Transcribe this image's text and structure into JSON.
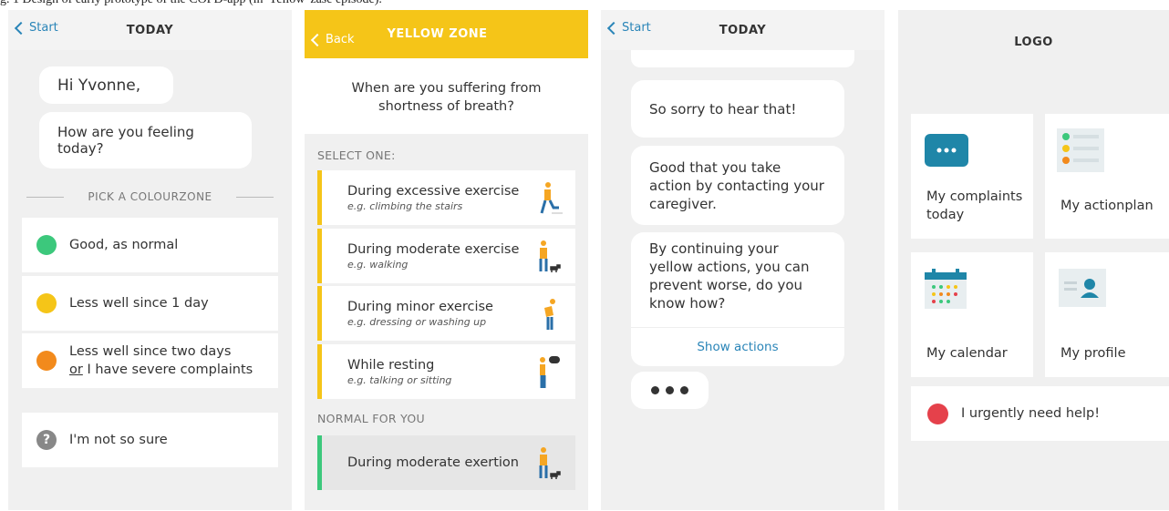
{
  "caption": "g. 1 Design of early prototype of the COPD-app (in 'Yellow' zase episode).",
  "screen1": {
    "back_label": "Start",
    "title": "TODAY",
    "greeting": "Hi Yvonne,",
    "question": "How are you feeling today?",
    "divider_label": "PICK A COLOURZONE",
    "zones": [
      {
        "label": "Good, as normal",
        "color": "#3cc87c"
      },
      {
        "label": "Less well since 1 day",
        "color": "#f5c518"
      },
      {
        "label_line1": "Less well since two days",
        "label_line2_or": "or",
        "label_line2_rest": " I have severe complaints",
        "color": "#f28a1c"
      }
    ],
    "unsure_label": "I'm not so sure",
    "unsure_icon": "?"
  },
  "screen2": {
    "back_label": "Back",
    "title": "YELLOW ZONE",
    "question_line1": "When are you suffering from",
    "question_line2": "shortness of breath?",
    "select_label": "SELECT ONE:",
    "options": [
      {
        "main": "During excessive exercise",
        "example": "e.g. climbing the stairs"
      },
      {
        "main": "During moderate exercise",
        "example": "e.g. walking"
      },
      {
        "main": "During minor exercise",
        "example": "e.g. dressing or washing up"
      },
      {
        "main": "While resting",
        "example": "e.g. talking or sitting"
      }
    ],
    "normal_label": "NORMAL FOR YOU",
    "normal_option": "During moderate exertion",
    "accent": "#f5c518",
    "normal_accent": "#3cc87c"
  },
  "screen3": {
    "back_label": "Start",
    "title": "TODAY",
    "messages": [
      "So sorry to hear that!",
      "Good that you take action by contacting your caregiver.",
      "By continuing your yellow actions, you can prevent worse, do you know how?"
    ],
    "show_actions": "Show actions"
  },
  "screen4": {
    "title": "LOGO",
    "tiles": [
      {
        "label_line1": "My complaints",
        "label_line2": "today",
        "icon": "chat-bubble-icon"
      },
      {
        "label": "My actionplan",
        "icon": "checklist-icon"
      },
      {
        "label": "My calendar",
        "icon": "calendar-icon"
      },
      {
        "label": "My profile",
        "icon": "profile-card-icon"
      }
    ],
    "urgent_label": "I urgently need help!",
    "urgent_color": "#e5414b"
  }
}
